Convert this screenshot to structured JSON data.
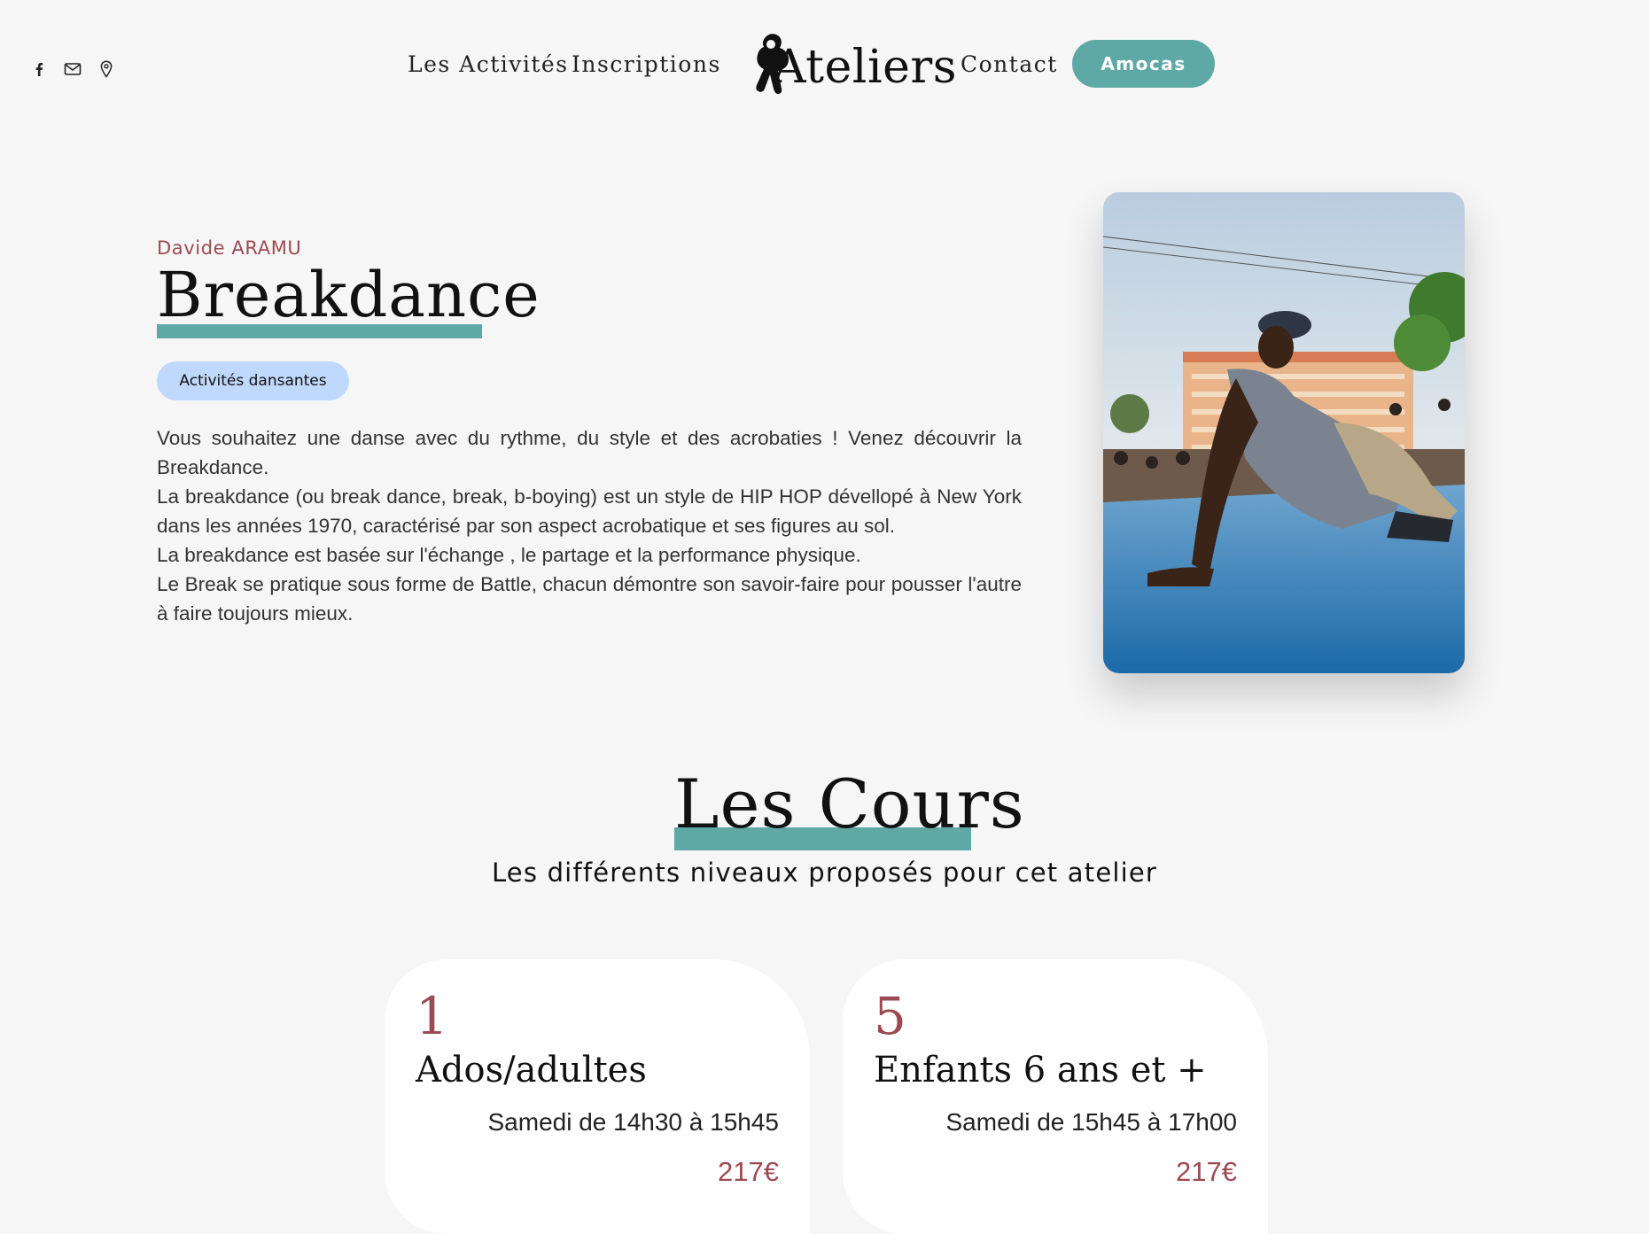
{
  "header": {
    "social_icons": [
      "facebook-icon",
      "mail-icon",
      "location-pin-icon"
    ],
    "nav": {
      "activities": "Les Activités",
      "inscriptions": "Inscriptions",
      "contact": "Contact"
    },
    "logo_text": "Ateliers",
    "cta": "Amocas"
  },
  "intro": {
    "teacher": "Davide ARAMU",
    "title": "Breakdance",
    "tag": "Activités dansantes",
    "paragraphs": [
      "Vous souhaitez une danse avec du rythme, du style et des acrobaties ! Venez découvrir la Breakdance.",
      "La breakdance (ou break dance, break, b-boying) est un style de HIP HOP dévellopé à New York dans les années 1970, caractérisé par son aspect acrobatique et ses figures au sol.",
      "La breakdance est basée sur l'échange , le partage et la performance physique.",
      "Le Break se pratique sous forme de Battle, chacun démontre son savoir-faire pour pousser l'autre à faire toujours mieux."
    ]
  },
  "courses": {
    "title": "Les Cours",
    "subtitle": "Les différents niveaux proposés pour cet atelier",
    "cards": [
      {
        "number": "1",
        "name": "Ados/adultes",
        "time": "Samedi de 14h30 à 15h45",
        "price": "217€"
      },
      {
        "number": "5",
        "name": "Enfants 6 ans et +",
        "time": "Samedi de 15h45 à 17h00",
        "price": "217€"
      }
    ]
  },
  "colors": {
    "accent_teal": "#5ea9a6",
    "accent_burgundy": "#9c4a52",
    "tag_blue": "#c0d8fb",
    "background": "#f6f6f6"
  }
}
